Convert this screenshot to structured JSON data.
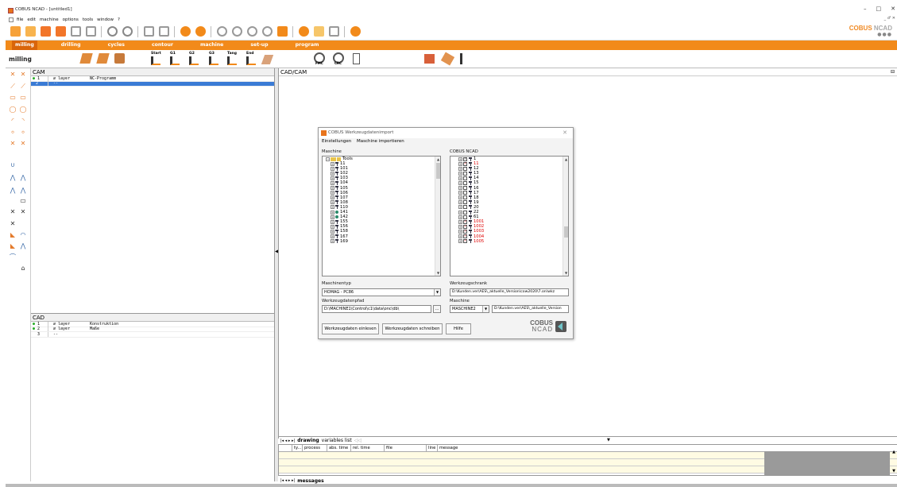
{
  "window": {
    "title": "COBUS NCAD - [untitled1]",
    "controls": [
      "–",
      "□",
      "✕"
    ],
    "inner_controls": "_ ♂ ✕"
  },
  "menu": [
    "file",
    "edit",
    "machine",
    "options",
    "tools",
    "window",
    "?"
  ],
  "brand": {
    "name_a": "COBUS",
    "name_b": " NCAD",
    "dots": "●●●"
  },
  "tabs": [
    "milling",
    "drilling",
    "cycles",
    "contour",
    "machine",
    "set-up",
    "program"
  ],
  "toolbar2": {
    "label": "milling",
    "icon_labels": [
      "Start",
      "G1",
      "G2",
      "G3",
      "Tang",
      "End"
    ],
    "fmc": "FMC",
    "crc": "CRC"
  },
  "cam": {
    "title": "CAM",
    "rows": [
      {
        "num": "1",
        "type": "layer",
        "name": "NC-Programm"
      },
      {
        "num": "2",
        "type": "--",
        "name": ""
      }
    ]
  },
  "cad": {
    "title": "CAD",
    "rows": [
      {
        "num": "1",
        "type": "layer",
        "name": "Konstruktion"
      },
      {
        "num": "2",
        "type": "layer",
        "name": "Maße"
      },
      {
        "num": "3",
        "type": "--",
        "name": ""
      }
    ]
  },
  "main": {
    "title": "CAD/CAM"
  },
  "bottom_tabs": {
    "nav": "|◂ ◂ ▸ ▸|",
    "drawing": "drawing",
    "variables": "variables list"
  },
  "messages": {
    "columns": [
      "ty...",
      "process",
      "abs. time",
      "rel. time",
      "file",
      "line",
      "message"
    ],
    "tab": "messages"
  },
  "dialog": {
    "title": "COBUS Werkzeugdatenimport",
    "menu": [
      "Einstellungen",
      "Maschine importieren"
    ],
    "left_label": "Maschine",
    "right_label": "COBUS NCAD",
    "left_root": "Tools",
    "left_items": [
      {
        "label": "11",
        "dot": false
      },
      {
        "label": "101",
        "dot": false
      },
      {
        "label": "102",
        "dot": false
      },
      {
        "label": "103",
        "dot": false
      },
      {
        "label": "104",
        "dot": false
      },
      {
        "label": "105",
        "dot": false
      },
      {
        "label": "106",
        "dot": false
      },
      {
        "label": "107",
        "dot": false
      },
      {
        "label": "108",
        "dot": false
      },
      {
        "label": "110",
        "dot": false
      },
      {
        "label": "141",
        "dot": true
      },
      {
        "label": "142",
        "dot": true
      },
      {
        "label": "155",
        "dot": false
      },
      {
        "label": "156",
        "dot": false
      },
      {
        "label": "158",
        "dot": false
      },
      {
        "label": "167",
        "dot": false
      },
      {
        "label": "169",
        "dot": false
      }
    ],
    "right_items": [
      {
        "label": "1",
        "checked": true,
        "red": false
      },
      {
        "label": "11",
        "checked": true,
        "red": true
      },
      {
        "label": "12",
        "checked": false,
        "red": false
      },
      {
        "label": "13",
        "checked": false,
        "red": false
      },
      {
        "label": "14",
        "checked": false,
        "red": false
      },
      {
        "label": "15",
        "checked": false,
        "red": false
      },
      {
        "label": "16",
        "checked": false,
        "red": false
      },
      {
        "label": "17",
        "checked": false,
        "red": false
      },
      {
        "label": "18",
        "checked": false,
        "red": false
      },
      {
        "label": "19",
        "checked": false,
        "red": false
      },
      {
        "label": "20",
        "checked": false,
        "red": false
      },
      {
        "label": "22",
        "checked": false,
        "red": false
      },
      {
        "label": "61",
        "checked": false,
        "red": false
      },
      {
        "label": "1001",
        "checked": true,
        "red": true
      },
      {
        "label": "1002",
        "checked": true,
        "red": true
      },
      {
        "label": "1003",
        "checked": true,
        "red": true
      },
      {
        "label": "1004",
        "checked": true,
        "red": true
      },
      {
        "label": "1005",
        "checked": true,
        "red": true
      }
    ],
    "maschinentyp_label": "Maschinentyp",
    "maschinentyp_value": "HOMAG - PC86",
    "werkzeugschrank_label": "Werkzeugschrank",
    "werkzeugschrank_value": "D:\\Kunden.ver\\AES\\_aktuelle_Version\\cow2020\\7.on\\wkz",
    "pfad_label": "Werkzeugdatenpfad",
    "pfad_value": "D:\\MACHINE1\\Control\\c1\\data\\onc\\db\\",
    "browse": "...",
    "maschine_label": "Maschine",
    "maschine_value": "MASCHINE2",
    "maschine_path": "D:\\Kunden.ver\\AES\\_aktuelle_Version",
    "btn_read": "Werkzeugdaten einlesen",
    "btn_write": "Werkzeugdaten schreiben",
    "btn_help": "Hilfe",
    "logo_a": "COBUS",
    "logo_b": "NCAD"
  }
}
